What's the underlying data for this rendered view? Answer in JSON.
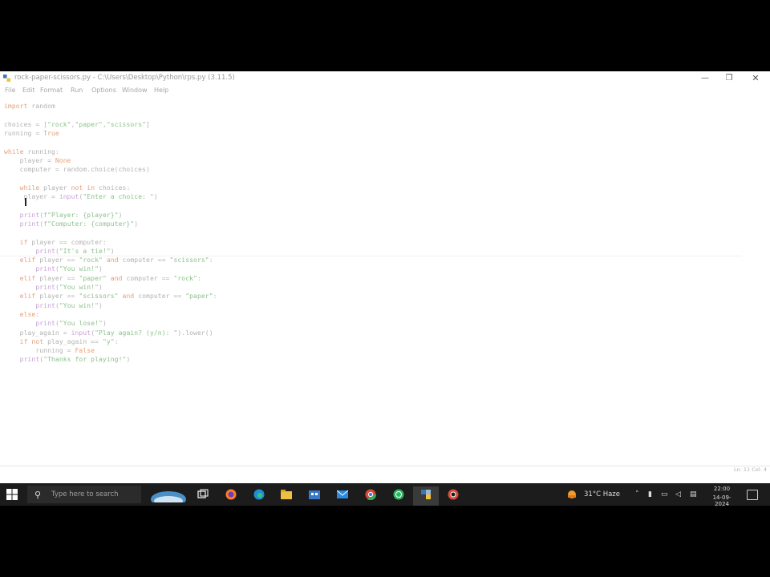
{
  "window": {
    "title": "rock-paper-scissors.py - C:\\Users\\Desktop\\Python\\rps.py (3.11.5)",
    "minimize": "—",
    "maximize": "❐",
    "close": "✕"
  },
  "menu": [
    "File",
    "Edit",
    "Format",
    "Run",
    "Options",
    "Window",
    "Help"
  ],
  "code_lines": [
    {
      "text": "import random"
    },
    {
      "text": ""
    },
    {
      "text": "choices = [\"rock\",\"paper\",\"scissors\"]"
    },
    {
      "text": "running = True"
    },
    {
      "text": ""
    },
    {
      "text": "while running:"
    },
    {
      "text": "    player = None"
    },
    {
      "text": "    computer = random.choice(choices)"
    },
    {
      "text": ""
    },
    {
      "text": "    while player not in choices:"
    },
    {
      "text": "     player = input(\"Enter a choice: \")"
    },
    {
      "text": ""
    },
    {
      "text": "    print(f\"Player: {player}\")"
    },
    {
      "text": "    print(f\"Computer: {computer}\")"
    },
    {
      "text": ""
    },
    {
      "text": "    if player == computer:"
    },
    {
      "text": "        print(\"It's a tie!\")"
    },
    {
      "text": "    elif player == \"rock\" and computer == \"scissors\":"
    },
    {
      "text": "        print(\"You win!\")"
    },
    {
      "text": "    elif player == \"paper\" and computer == \"rock\":"
    },
    {
      "text": "        print(\"You win!\")"
    },
    {
      "text": "    elif player == \"scissors\" and computer == \"paper\":"
    },
    {
      "text": "        print(\"You win!\")"
    },
    {
      "text": "    else:"
    },
    {
      "text": "        print(\"You lose!\")"
    },
    {
      "text": "    play_again = input(\"Play again? (y/n): \").lower()"
    },
    {
      "text": "    if not play_again == \"y\":"
    },
    {
      "text": "        running = False"
    },
    {
      "text": "    print(\"Thanks for playing!\")"
    }
  ],
  "status": {
    "position": "Ln: 11  Col: 4"
  },
  "taskbar": {
    "search_placeholder": "Type here to search",
    "weather": "31°C  Haze",
    "time": "22:00",
    "date": "14-09-2024",
    "icons": [
      "task-view-icon",
      "firefox-icon",
      "edge-icon",
      "file-explorer-icon",
      "store-icon",
      "mail-icon",
      "chrome-icon",
      "whatsapp-icon",
      "python-idle-icon",
      "chrome-alt-icon"
    ]
  },
  "colors": {
    "keyword": "#e4a07a",
    "string": "#8bc28b",
    "builtin": "#c8a0d8",
    "taskbar": "#1c1c1c"
  }
}
